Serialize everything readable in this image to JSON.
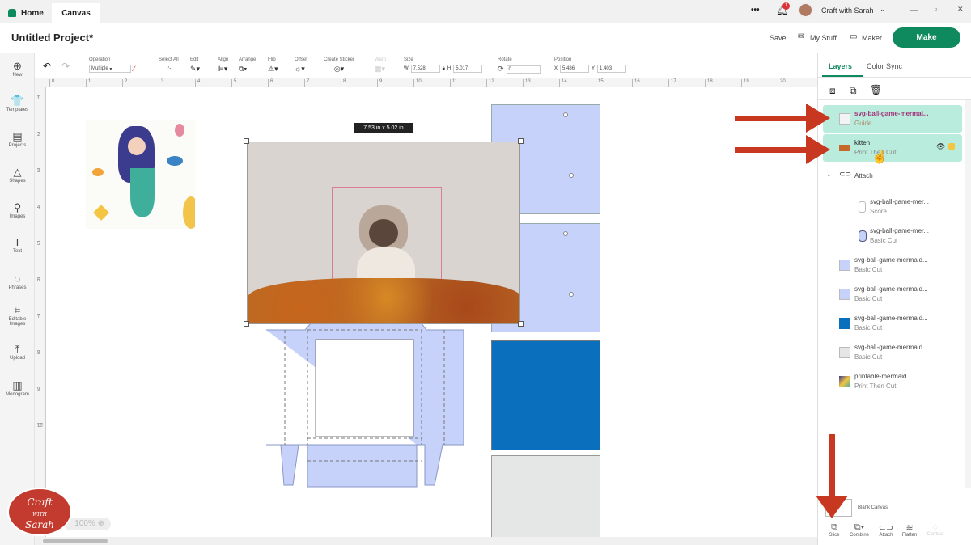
{
  "tabs": [
    {
      "label": "Home"
    },
    {
      "label": "Canvas"
    }
  ],
  "topbar": {
    "more": "•••",
    "notif_count": "1",
    "user": "Craft with Sarah"
  },
  "header": {
    "title": "Untitled Project*",
    "save": "Save",
    "my_stuff": "My Stuff",
    "maker": "Maker",
    "make": "Make"
  },
  "sidebar": [
    {
      "label": "New",
      "icon": "⊕"
    },
    {
      "label": "Templates",
      "icon": "👕"
    },
    {
      "label": "Projects",
      "icon": "▤"
    },
    {
      "label": "Shapes",
      "icon": "△"
    },
    {
      "label": "Images",
      "icon": "⚲"
    },
    {
      "label": "Text",
      "icon": "T"
    },
    {
      "label": "Phrases",
      "icon": "◌"
    },
    {
      "label": "Editable Images",
      "icon": "⌗"
    },
    {
      "label": "Upload",
      "icon": "⤒"
    },
    {
      "label": "Monogram",
      "icon": "▥"
    }
  ],
  "toolbar": {
    "operation_label": "Operation",
    "operation_value": "Multiple",
    "select_all": "Select All",
    "edit": "Edit",
    "align": "Align",
    "arrange": "Arrange",
    "flip": "Flip",
    "offset": "Offset",
    "create_sticker": "Create Sticker",
    "warp": "Warp",
    "size": "Size",
    "w_label": "W",
    "w": "7.528",
    "h_label": "H",
    "h": "5.017",
    "rotate": "Rotate",
    "rotate_value": "0",
    "position": "Position",
    "x_label": "X",
    "x": "5.486",
    "y_label": "Y",
    "y": "1.403"
  },
  "ruler": {
    "h": [
      "0",
      "1",
      "2",
      "3",
      "4",
      "5",
      "6",
      "7",
      "8",
      "9",
      "10",
      "11",
      "12",
      "13",
      "14",
      "15",
      "16",
      "17",
      "18",
      "19",
      "20"
    ],
    "v": [
      "1",
      "2",
      "3",
      "4",
      "5",
      "6",
      "7",
      "8",
      "9",
      "10"
    ]
  },
  "canvas": {
    "dimension_label": "7.53  in x 5.02  in",
    "zoom": "100%"
  },
  "panel": {
    "tabs": [
      "Layers",
      "Color Sync"
    ],
    "layers": [
      {
        "name": "svg-ball-game-mermai...",
        "type": "Guide"
      },
      {
        "name": "kitten",
        "type": "Print Then Cut"
      },
      {
        "name": "Attach",
        "type": ""
      },
      {
        "name": "svg-ball-game-mer...",
        "type": "Score"
      },
      {
        "name": "svg-ball-game-mer...",
        "type": "Basic Cut"
      },
      {
        "name": "svg-ball-game-mermaid...",
        "type": "Basic Cut"
      },
      {
        "name": "svg-ball-game-mermaid...",
        "type": "Basic Cut"
      },
      {
        "name": "svg-ball-game-mermaid...",
        "type": "Basic Cut"
      },
      {
        "name": "svg-ball-game-mermaid...",
        "type": "Basic Cut"
      },
      {
        "name": "printable-mermaid",
        "type": "Print Then Cut"
      }
    ],
    "blank_canvas": "Blank Canvas",
    "actions": [
      "Slice",
      "Combine",
      "Attach",
      "Flatten",
      "Contour"
    ]
  },
  "logo": {
    "text": "Craft with Sarah"
  },
  "colors": {
    "accent": "#0f8a5f",
    "layer_selected": "#b9ecdc",
    "arrow": "#c8371f",
    "shape_light": "#c7d2fb",
    "shape_dark": "#0a6fbd"
  }
}
